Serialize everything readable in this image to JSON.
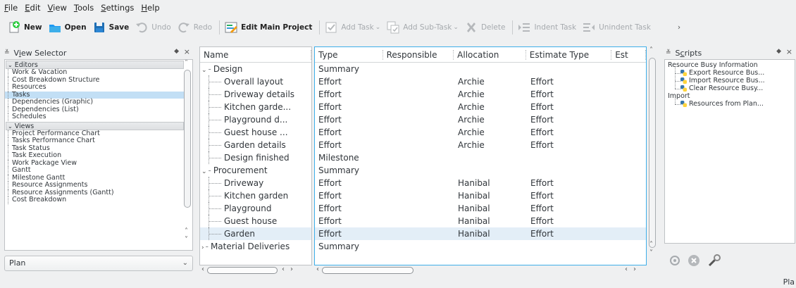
{
  "menu": [
    {
      "pre": "",
      "u": "F",
      "post": "ile"
    },
    {
      "pre": "",
      "u": "E",
      "post": "dit"
    },
    {
      "pre": "",
      "u": "V",
      "post": "iew"
    },
    {
      "pre": "",
      "u": "T",
      "post": "ools"
    },
    {
      "pre": "",
      "u": "S",
      "post": "ettings"
    },
    {
      "pre": "",
      "u": "H",
      "post": "elp"
    }
  ],
  "toolbar": {
    "new": "New",
    "open": "Open",
    "save": "Save",
    "undo": "Undo",
    "redo": "Redo",
    "edit_main_project": "Edit Main Project",
    "add_task": "Add Task",
    "add_sub_task": "Add Sub-Task",
    "delete": "Delete",
    "indent_task": "Indent Task",
    "unindent_task": "Unindent Task"
  },
  "view_selector": {
    "title_pre": "V",
    "title_u": "i",
    "title_post": "ew Selector",
    "groups": [
      {
        "label": "Editors",
        "items": [
          {
            "label": "Work & Vacation",
            "selected": false
          },
          {
            "label": "Cost Breakdown Structure",
            "selected": false
          },
          {
            "label": "Resources",
            "selected": false
          },
          {
            "label": "Tasks",
            "selected": true
          },
          {
            "label": "Dependencies (Graphic)",
            "selected": false
          },
          {
            "label": "Dependencies (List)",
            "selected": false
          },
          {
            "label": "Schedules",
            "selected": false
          }
        ]
      },
      {
        "label": "Views",
        "items": [
          {
            "label": "Project Performance Chart",
            "selected": false
          },
          {
            "label": "Tasks Performance Chart",
            "selected": false
          },
          {
            "label": "Task Status",
            "selected": false
          },
          {
            "label": "Task Execution",
            "selected": false
          },
          {
            "label": "Work Package View",
            "selected": false
          },
          {
            "label": "Gantt",
            "selected": false
          },
          {
            "label": "Milestone Gantt",
            "selected": false
          },
          {
            "label": "Resource Assignments",
            "selected": false
          },
          {
            "label": "Resource Assignments (Gantt)",
            "selected": false
          },
          {
            "label": "Cost Breakdown",
            "selected": false
          }
        ]
      }
    ],
    "combo_value": "Plan"
  },
  "task_table": {
    "name_header": "Name",
    "columns": [
      "Type",
      "Responsible",
      "Allocation",
      "Estimate Type",
      "Est"
    ],
    "rows": [
      {
        "name": "Design",
        "level": 0,
        "type": "Summary",
        "responsible": "",
        "allocation": "",
        "estimate_type": "",
        "selected": false
      },
      {
        "name": "Overall layout",
        "level": 1,
        "type": "Effort",
        "responsible": "",
        "allocation": "Archie",
        "estimate_type": "Effort",
        "selected": false
      },
      {
        "name": "Driveway details",
        "level": 1,
        "type": "Effort",
        "responsible": "",
        "allocation": "Archie",
        "estimate_type": "Effort",
        "selected": false
      },
      {
        "name": "Kitchen garde...",
        "level": 1,
        "type": "Effort",
        "responsible": "",
        "allocation": "Archie",
        "estimate_type": "Effort",
        "selected": false
      },
      {
        "name": "Playground d...",
        "level": 1,
        "type": "Effort",
        "responsible": "",
        "allocation": "Archie",
        "estimate_type": "Effort",
        "selected": false
      },
      {
        "name": "Guest house ...",
        "level": 1,
        "type": "Effort",
        "responsible": "",
        "allocation": "Archie",
        "estimate_type": "Effort",
        "selected": false
      },
      {
        "name": "Garden details",
        "level": 1,
        "type": "Effort",
        "responsible": "",
        "allocation": "Archie",
        "estimate_type": "Effort",
        "selected": false
      },
      {
        "name": "Design finished",
        "level": 1,
        "type": "Milestone",
        "responsible": "",
        "allocation": "",
        "estimate_type": "",
        "selected": false
      },
      {
        "name": "Procurement",
        "level": 0,
        "type": "Summary",
        "responsible": "",
        "allocation": "",
        "estimate_type": "",
        "selected": false
      },
      {
        "name": "Driveway",
        "level": 1,
        "type": "Effort",
        "responsible": "",
        "allocation": "Hanibal",
        "estimate_type": "Effort",
        "selected": false
      },
      {
        "name": "Kitchen garden",
        "level": 1,
        "type": "Effort",
        "responsible": "",
        "allocation": "Hanibal",
        "estimate_type": "Effort",
        "selected": false
      },
      {
        "name": "Playground",
        "level": 1,
        "type": "Effort",
        "responsible": "",
        "allocation": "Hanibal",
        "estimate_type": "Effort",
        "selected": false
      },
      {
        "name": "Guest house",
        "level": 1,
        "type": "Effort",
        "responsible": "",
        "allocation": "Hanibal",
        "estimate_type": "Effort",
        "selected": false
      },
      {
        "name": "Garden",
        "level": 1,
        "type": "Effort",
        "responsible": "",
        "allocation": "Hanibal",
        "estimate_type": "Effort",
        "selected": true
      },
      {
        "name": "Material Deliveries",
        "level": 0,
        "type": "Summary",
        "responsible": "",
        "allocation": "",
        "estimate_type": "",
        "selected": false,
        "collapsed": true
      }
    ]
  },
  "scripts_panel": {
    "title_pre": "S",
    "title_u": "c",
    "title_post": "ripts",
    "tree": [
      {
        "label": "Resource Busy Information",
        "level": 0
      },
      {
        "label": "Export Resource Bus...",
        "level": 1
      },
      {
        "label": "Import Resource Bus...",
        "level": 1
      },
      {
        "label": "Clear Resource Busy...",
        "level": 1
      },
      {
        "label": "Import",
        "level": 0
      },
      {
        "label": "Resources from Plan...",
        "level": 1
      }
    ]
  },
  "status": {
    "text": "Pla"
  },
  "colors": {
    "accent": "#3daee9",
    "selection": "#c2dff5",
    "row_selection": "#e3eef7",
    "background": "#eff0f1"
  }
}
